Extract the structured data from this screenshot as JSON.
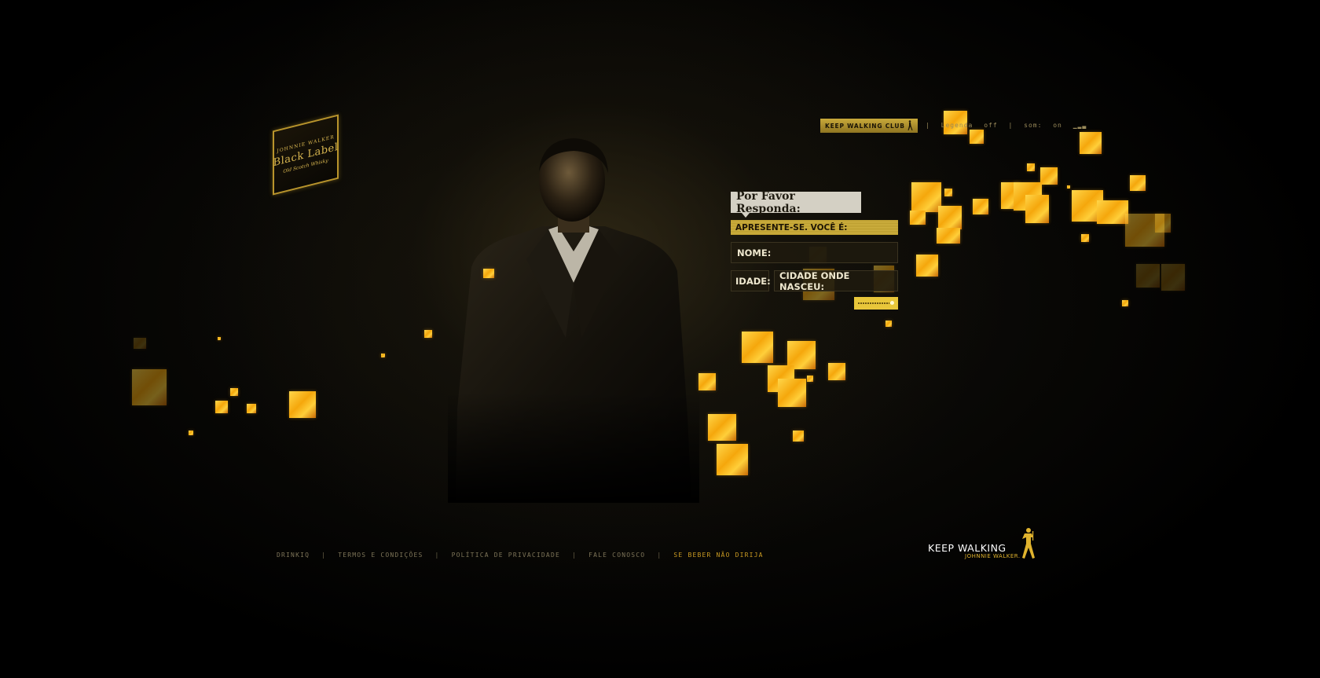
{
  "logo": {
    "brand_line": "Johnnie Walker",
    "name": "Black Label",
    "subtitle": "Old Scotch Whisky"
  },
  "topnav": {
    "club_button": "Keep Walking Club",
    "legenda": "Legenda",
    "off": "off",
    "sound_label": "som:",
    "sound_value": "on"
  },
  "form": {
    "title": "Por Favor Responda:",
    "present_label": "APRESENTE-SE. VOCÊ É:",
    "name_label": "NOME:",
    "age_label": "IDADE:",
    "city_label": "CIDADE ONDE NASCEU:"
  },
  "footer": {
    "links": [
      "Drinkiq",
      "Termos e Condições",
      "Política de Privacidade",
      "Fale Conosco"
    ],
    "warning": "Se beber não dirija"
  },
  "brand": {
    "tagline": "KEEP WALKING",
    "name": "JOHNNIE WALKER."
  },
  "colors": {
    "accent_gold": "#d2b443",
    "flame_yellow": "#ffd64a",
    "background": "#000000"
  },
  "icons": [
    "striding-man-icon",
    "sound-level-icon",
    "slider-icon"
  ]
}
